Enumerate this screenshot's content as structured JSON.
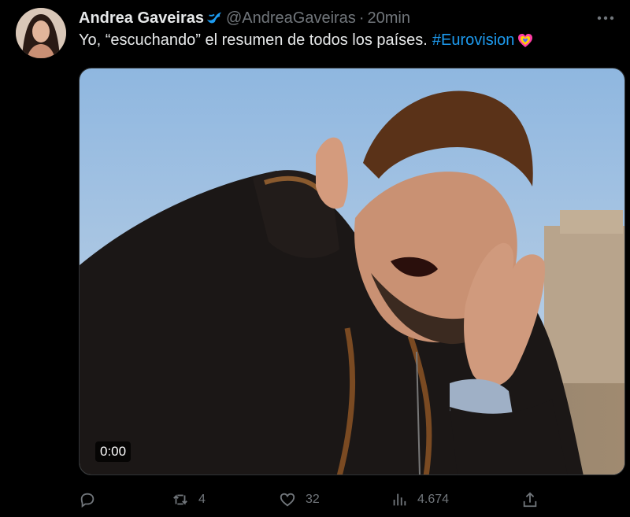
{
  "tweet": {
    "author_name": "Andrea Gaveiras",
    "handle": "@AndreaGaveiras",
    "separator": "·",
    "time_ago": "20min",
    "text": "Yo, “escuchando” el resumen de todos los países.",
    "hashtag": "#Eurovision",
    "more_icon": "more-horizontal-icon",
    "verified_icon": "blue-bird-icon"
  },
  "media": {
    "type": "video",
    "timestamp": "0:00"
  },
  "actions": {
    "reply": {
      "icon": "reply-icon",
      "count": ""
    },
    "retweet": {
      "icon": "retweet-icon",
      "count": "4"
    },
    "like": {
      "icon": "heart-icon",
      "count": "32"
    },
    "views": {
      "icon": "views-chart-icon",
      "count": "4.674"
    },
    "share": {
      "icon": "share-icon",
      "count": ""
    }
  },
  "colors": {
    "background": "#000000",
    "text": "#e7e9ea",
    "muted": "#71767b",
    "link": "#1d9bf0"
  }
}
